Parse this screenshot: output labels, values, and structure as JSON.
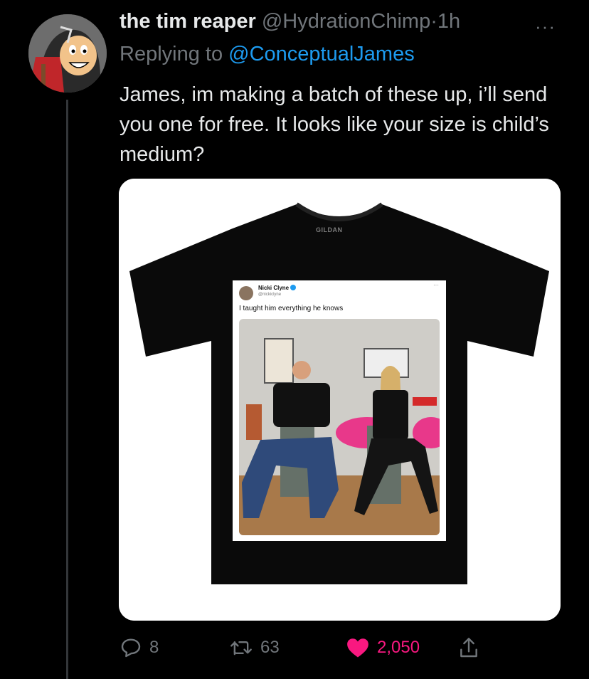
{
  "tweet": {
    "display_name": "the tim reaper",
    "handle": "@HydrationChimp",
    "separator": "·",
    "time": "1h",
    "more": "···",
    "replying_prefix": "Replying to",
    "replying_to": "@ConceptualJames",
    "text": "James, im making a batch of these up, i’ll send you one for free. It looks like your size is child’s medium?"
  },
  "media": {
    "shirt_brand": "GILDAN",
    "inner_tweet": {
      "name": "Nicki Clyne",
      "handle": "@nickiclyne",
      "more": "···",
      "text": "I taught him everything he knows"
    }
  },
  "actions": {
    "replies": "8",
    "retweets": "63",
    "likes": "2,050"
  },
  "colors": {
    "background": "#000000",
    "primary_text": "#e7e9ea",
    "secondary_text": "#71767b",
    "link": "#1d9bf0",
    "like": "#f91880"
  }
}
